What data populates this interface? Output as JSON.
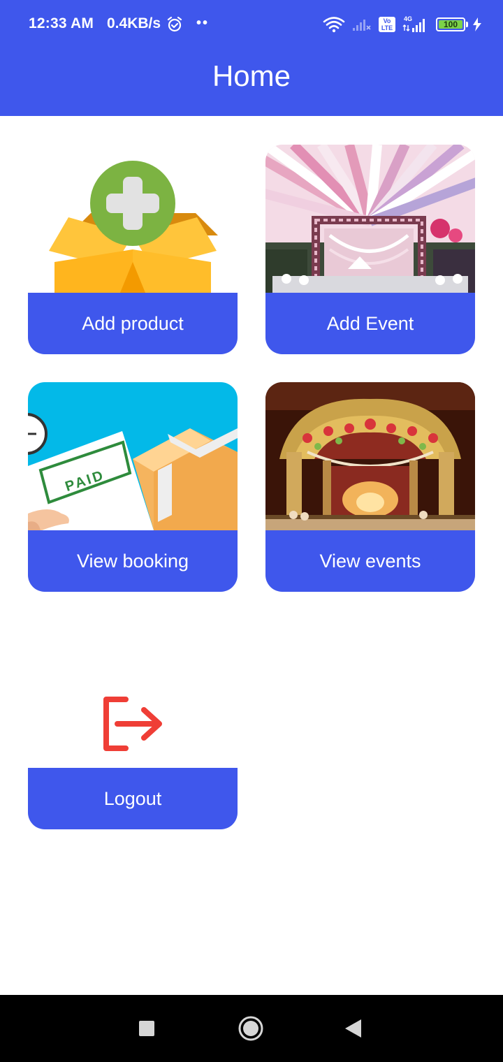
{
  "status_bar": {
    "time": "12:33 AM",
    "speed": "0.4KB/s",
    "dots": "••",
    "network_type": "4G",
    "volte_label": "Vo LTE",
    "battery": "100"
  },
  "app_bar": {
    "title": "Home"
  },
  "cards": [
    {
      "label": "Add product",
      "image": "box-with-plus-icon"
    },
    {
      "label": "Add Event",
      "image": "event-decoration-photo"
    },
    {
      "label": "View booking",
      "image": "paid-receipt-illustration"
    },
    {
      "label": "View events",
      "image": "stage-decoration-photo"
    },
    {
      "label": "Logout",
      "image": "logout-icon"
    }
  ],
  "colors": {
    "primary": "#3f57ec",
    "logout_icon": "#ef3e36",
    "background": "#ffffff",
    "nav_bar": "#000000"
  },
  "navigation": {
    "recents": "square-icon",
    "home": "circle-icon",
    "back": "triangle-back-icon"
  }
}
